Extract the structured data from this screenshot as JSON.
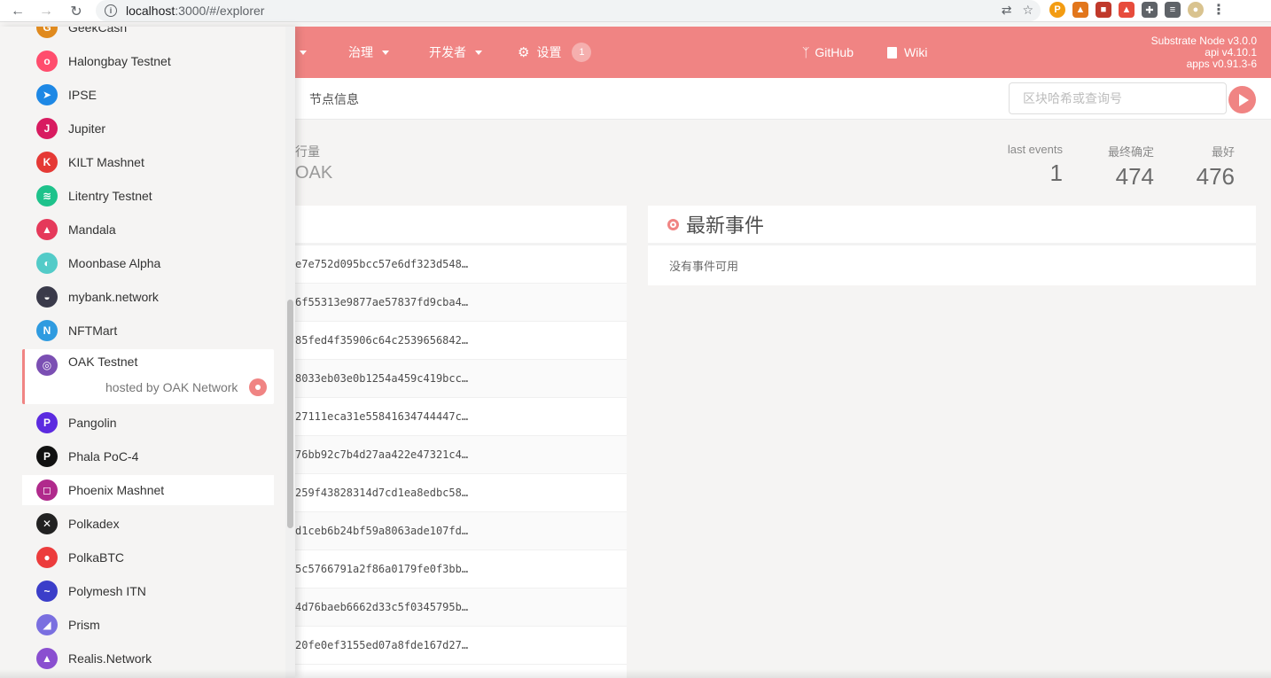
{
  "browser": {
    "url_host": "localhost",
    "url_rest": ":3000/#/explorer"
  },
  "header": {
    "menus": [
      {
        "label": "治理"
      },
      {
        "label": "开发者"
      },
      {
        "label": "设置",
        "badge": "1"
      }
    ],
    "links": [
      {
        "label": "GitHub"
      },
      {
        "label": "Wiki"
      }
    ],
    "version": {
      "node": "Substrate Node v3.0.0",
      "api": "api v4.10.1",
      "apps": "apps v0.91.3-6"
    },
    "accent": "#f08483"
  },
  "subheader": {
    "tab": "节点信息",
    "search_placeholder": "区块哈希或查询号"
  },
  "summary": {
    "left_label": "行量",
    "left_value": "OAK",
    "stats": [
      {
        "label": "last events",
        "value": "1"
      },
      {
        "label": "最终确定",
        "value": "474"
      },
      {
        "label": "最好",
        "value": "476"
      }
    ]
  },
  "blocks": [
    "e7e752d095bcc57e6df323d548…",
    "6f55313e9877ae57837fd9cba4…",
    "85fed4f35906c64c2539656842…",
    "8033eb03e0b1254a459c419bcc…",
    "27111eca31e55841634744447c…",
    "76bb92c7b4d27aa422e47321c4…",
    "259f43828314d7cd1ea8edbc58…",
    "d1ceb6b24bf59a8063ade107fd…",
    "5c5766791a2f86a0179fe0f3bb…",
    "4d76baeb6662d33c5f0345795b…",
    "20fe0ef3155ed07a8fde167d27…"
  ],
  "events": {
    "title": "最新事件",
    "empty": "没有事件可用"
  },
  "sidebar": {
    "chains": [
      {
        "name": "GeekCash",
        "color": "#e08a1e",
        "glyph": "G"
      },
      {
        "name": "Halongbay Testnet",
        "color": "#ff4d6d",
        "glyph": "o"
      },
      {
        "name": "IPSE",
        "color": "#1e88e5",
        "glyph": "➤"
      },
      {
        "name": "Jupiter",
        "color": "#d81b60",
        "glyph": "J"
      },
      {
        "name": "KILT Mashnet",
        "color": "#e53935",
        "glyph": "K"
      },
      {
        "name": "Litentry Testnet",
        "color": "#1ec28b",
        "glyph": "≋"
      },
      {
        "name": "Mandala",
        "color": "#e5395a",
        "glyph": "▲"
      },
      {
        "name": "Moonbase Alpha",
        "color": "#53cbc8",
        "glyph": "◐"
      },
      {
        "name": "mybank.network",
        "color": "#3a3a4a",
        "glyph": "◒"
      },
      {
        "name": "NFTMart",
        "color": "#2f9be0",
        "glyph": "N"
      },
      {
        "name": "OAK Testnet",
        "color": "#7b4fb3",
        "glyph": "◎",
        "hosted": "hosted by OAK Network"
      },
      {
        "name": "Pangolin",
        "color": "#5c2be0",
        "glyph": "P"
      },
      {
        "name": "Phala PoC-4",
        "color": "#111111",
        "glyph": "P"
      },
      {
        "name": "Phoenix Mashnet",
        "color": "#b02a8c",
        "glyph": "◻"
      },
      {
        "name": "Polkadex",
        "color": "#222222",
        "glyph": "✕"
      },
      {
        "name": "PolkaBTC",
        "color": "#ec3c3c",
        "glyph": "●"
      },
      {
        "name": "Polymesh ITN",
        "color": "#3b3ec9",
        "glyph": "~"
      },
      {
        "name": "Prism",
        "color": "#7a6fe0",
        "glyph": "◢"
      },
      {
        "name": "Realis.Network",
        "color": "#8a4fd0",
        "glyph": "▲"
      }
    ]
  }
}
